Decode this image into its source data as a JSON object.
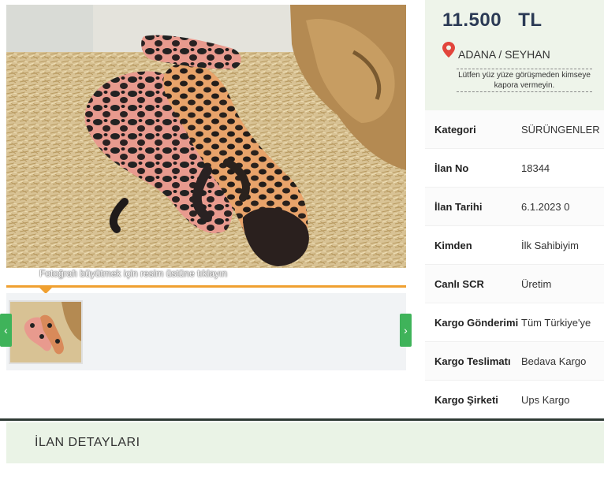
{
  "gallery": {
    "caption": "Fotoğrafı büyütmek için resim üstüne tıklayın",
    "prev_icon": "chevron-left-icon",
    "next_icon": "chevron-right-icon"
  },
  "listing": {
    "price": "11.500 TL",
    "location": "ADANA / SEYHAN",
    "location_icon": "map-pin-icon",
    "warning": "Lütfen yüz yüze görüşmeden kimseye kapora vermeyin."
  },
  "details": [
    {
      "label": "Kategori",
      "value": "SÜRÜNGENLER"
    },
    {
      "label": "İlan No",
      "value": "18344"
    },
    {
      "label": "İlan Tarihi",
      "value": "6.1.2023 0"
    },
    {
      "label": "Kimden",
      "value": "İlk Sahibiyim"
    },
    {
      "label": "Canlı SCR",
      "value": "Üretim"
    },
    {
      "label": "Kargo Gönderimi",
      "value": "Tüm Türkiye'ye"
    },
    {
      "label": "Kargo Teslimatı",
      "value": "Bedava Kargo"
    },
    {
      "label": "Kargo Şirketi",
      "value": "Ups Kargo"
    }
  ],
  "section": {
    "title": "İLAN DETAYLARI"
  },
  "colors": {
    "accent_orange": "#f0a030",
    "accent_green": "#3fb35a",
    "price_text": "#2b3a55",
    "pin_red": "#e2453c"
  }
}
